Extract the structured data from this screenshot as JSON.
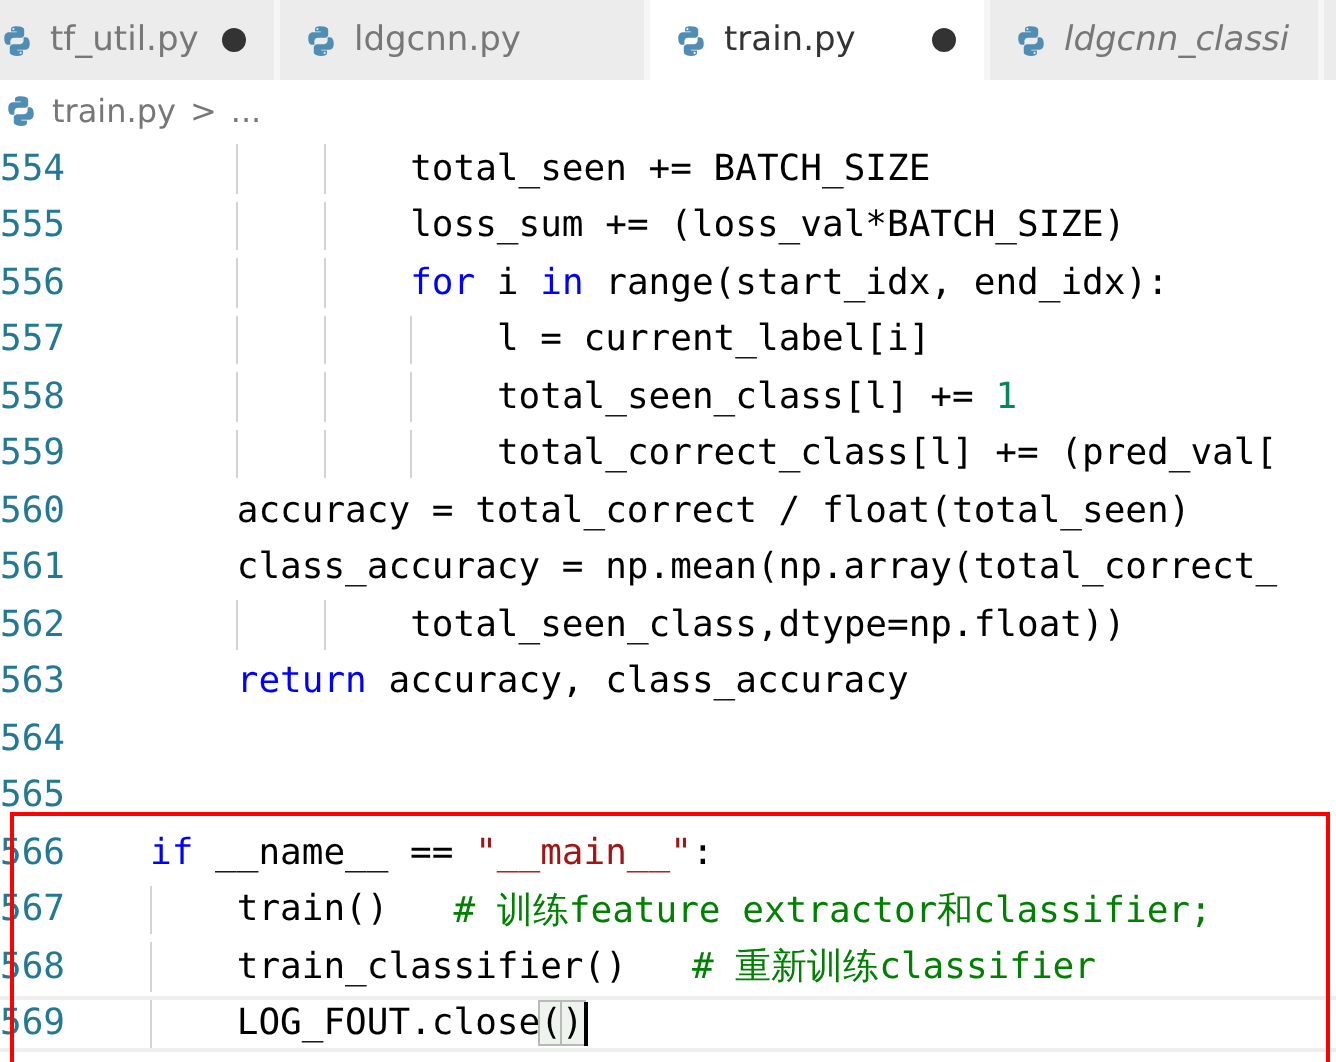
{
  "tabs": [
    {
      "label": "tf_util.py",
      "selected": false,
      "modified": true,
      "preview": false
    },
    {
      "label": "ldgcnn.py",
      "selected": false,
      "modified": false,
      "preview": false
    },
    {
      "label": "train.py",
      "selected": true,
      "modified": true,
      "preview": false
    },
    {
      "label": "ldgcnn_classi",
      "selected": false,
      "modified": false,
      "preview": true
    }
  ],
  "breadcrumb": {
    "file": "train.py",
    "separator": ">",
    "rest": "..."
  },
  "lines": [
    {
      "number": "554",
      "current": false,
      "tokens": [
        {
          "kind": "plain",
          "text": "            total_seen += BATCH_SIZE"
        }
      ]
    },
    {
      "number": "555",
      "current": false,
      "tokens": [
        {
          "kind": "plain",
          "text": "            loss_sum += (loss_val*BATCH_SIZE)"
        }
      ]
    },
    {
      "number": "556",
      "current": false,
      "tokens": [
        {
          "kind": "keyword",
          "text": "            for"
        },
        {
          "kind": "plain",
          "text": " i "
        },
        {
          "kind": "keyword",
          "text": "in"
        },
        {
          "kind": "plain",
          "text": " range(start_idx, end_idx):"
        }
      ]
    },
    {
      "number": "557",
      "current": false,
      "tokens": [
        {
          "kind": "plain",
          "text": "                l = current_label[i]"
        }
      ]
    },
    {
      "number": "558",
      "current": false,
      "tokens": [
        {
          "kind": "plain",
          "text": "                total_seen_class[l] += "
        },
        {
          "kind": "number",
          "text": "1"
        }
      ]
    },
    {
      "number": "559",
      "current": false,
      "tokens": [
        {
          "kind": "plain",
          "text": "                total_correct_class[l] += (pred_val["
        }
      ]
    },
    {
      "number": "560",
      "current": false,
      "tokens": [
        {
          "kind": "plain",
          "text": "    accuracy = total_correct / float(total_seen)"
        }
      ]
    },
    {
      "number": "561",
      "current": false,
      "tokens": [
        {
          "kind": "plain",
          "text": "    class_accuracy = np.mean(np.array(total_correct_"
        }
      ]
    },
    {
      "number": "562",
      "current": false,
      "tokens": [
        {
          "kind": "plain",
          "text": "            total_seen_class,dtype=np.float))"
        }
      ]
    },
    {
      "number": "563",
      "current": false,
      "tokens": [
        {
          "kind": "keyword",
          "text": "    return"
        },
        {
          "kind": "plain",
          "text": " accuracy, class_accuracy"
        }
      ]
    },
    {
      "number": "564",
      "current": false
    },
    {
      "number": "565",
      "current": false
    },
    {
      "number": "566",
      "current": false,
      "tokens": [
        {
          "kind": "keyword",
          "text": "if"
        },
        {
          "kind": "plain",
          "text": " __name__ == "
        },
        {
          "kind": "string",
          "text": "\"__main__\""
        },
        {
          "kind": "plain",
          "text": ":"
        }
      ]
    },
    {
      "number": "567",
      "current": false,
      "tokens": [
        {
          "kind": "plain",
          "text": "    train()   "
        },
        {
          "kind": "comment",
          "text": "# 训练feature extractor和classifier;"
        }
      ]
    },
    {
      "number": "568",
      "current": false,
      "tokens": [
        {
          "kind": "plain",
          "text": "    train_classifier()   "
        },
        {
          "kind": "comment",
          "text": "# 重新训练classifier"
        }
      ]
    },
    {
      "number": "569",
      "current": true,
      "tokens": [
        {
          "kind": "plain",
          "text": "    LOG_FOUT.close"
        },
        {
          "kind": "bracket",
          "text": "("
        },
        {
          "kind": "bracket",
          "text": ")"
        }
      ]
    }
  ]
}
